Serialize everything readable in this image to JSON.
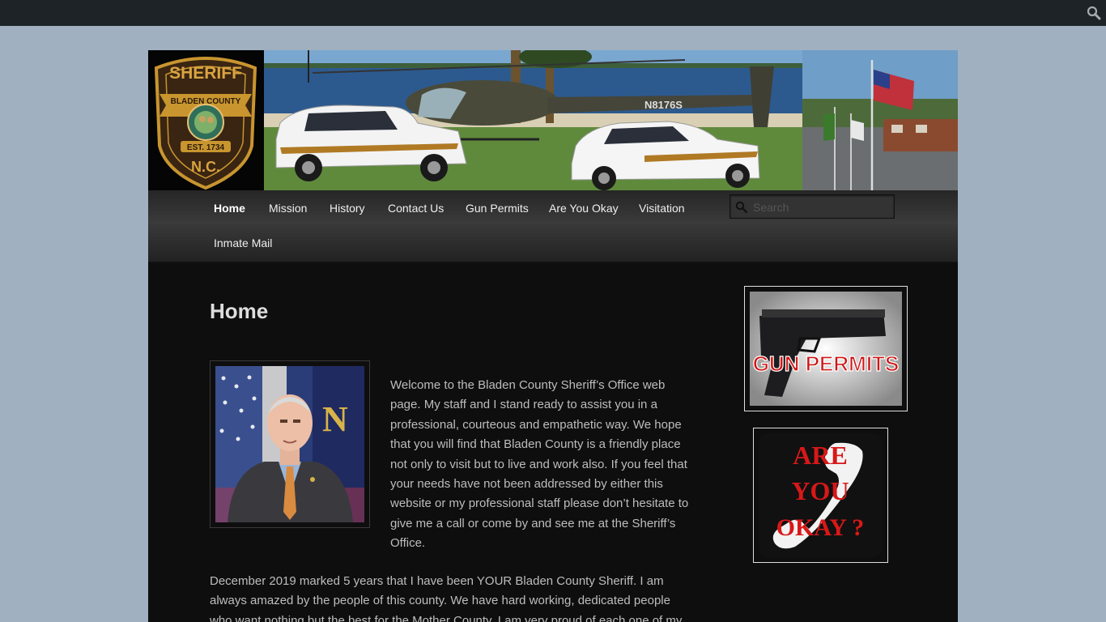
{
  "adminbar": {
    "search_icon": "search-icon"
  },
  "banner": {
    "badge": {
      "top_text": "SHERIFF",
      "ribbon_text": "BLADEN COUNTY",
      "est_text": "EST. 1734",
      "bottom_text": "N.C."
    },
    "helicopter_tail": "N8176S",
    "colors": {
      "badge_gold": "#c8952f",
      "badge_brown": "#3a2512",
      "sky": "#6f9ec8",
      "water": "#2d5a8e",
      "grass": "#5f8a3c"
    }
  },
  "nav": {
    "items": [
      {
        "label": "Home"
      },
      {
        "label": "Mission"
      },
      {
        "label": "History"
      },
      {
        "label": "Contact Us"
      },
      {
        "label": "Gun Permits"
      },
      {
        "label": "Are You Okay"
      },
      {
        "label": "Visitation"
      },
      {
        "label": "Inmate Mail"
      }
    ],
    "search_placeholder": "Search"
  },
  "main": {
    "title": "Home",
    "paragraph1": "Welcome to the Bladen County Sheriff’s Office web page. My staff and I stand ready to assist you in a professional, courteous and empathetic way. We hope that you will find that Bladen County is a friendly place not only to visit but to live and work also. If you feel that your needs have not been addressed by either this website or my professional staff please don’t hesitate to give me a call or come by and see me at the Sheriff’s Office.",
    "paragraph2": "December 2019 marked 5 years that I have been YOUR Bladen County Sheriff. I am always amazed by the people of this county. We have hard working, dedicated people who want nothing but the best for the Mother County. I am very proud of each one of my"
  },
  "sidebar": {
    "gun_permits": {
      "label": "GUN PERMITS"
    },
    "are_you_okay": {
      "line1": "ARE",
      "line2": "YOU",
      "line3": "OKAY ?"
    }
  }
}
